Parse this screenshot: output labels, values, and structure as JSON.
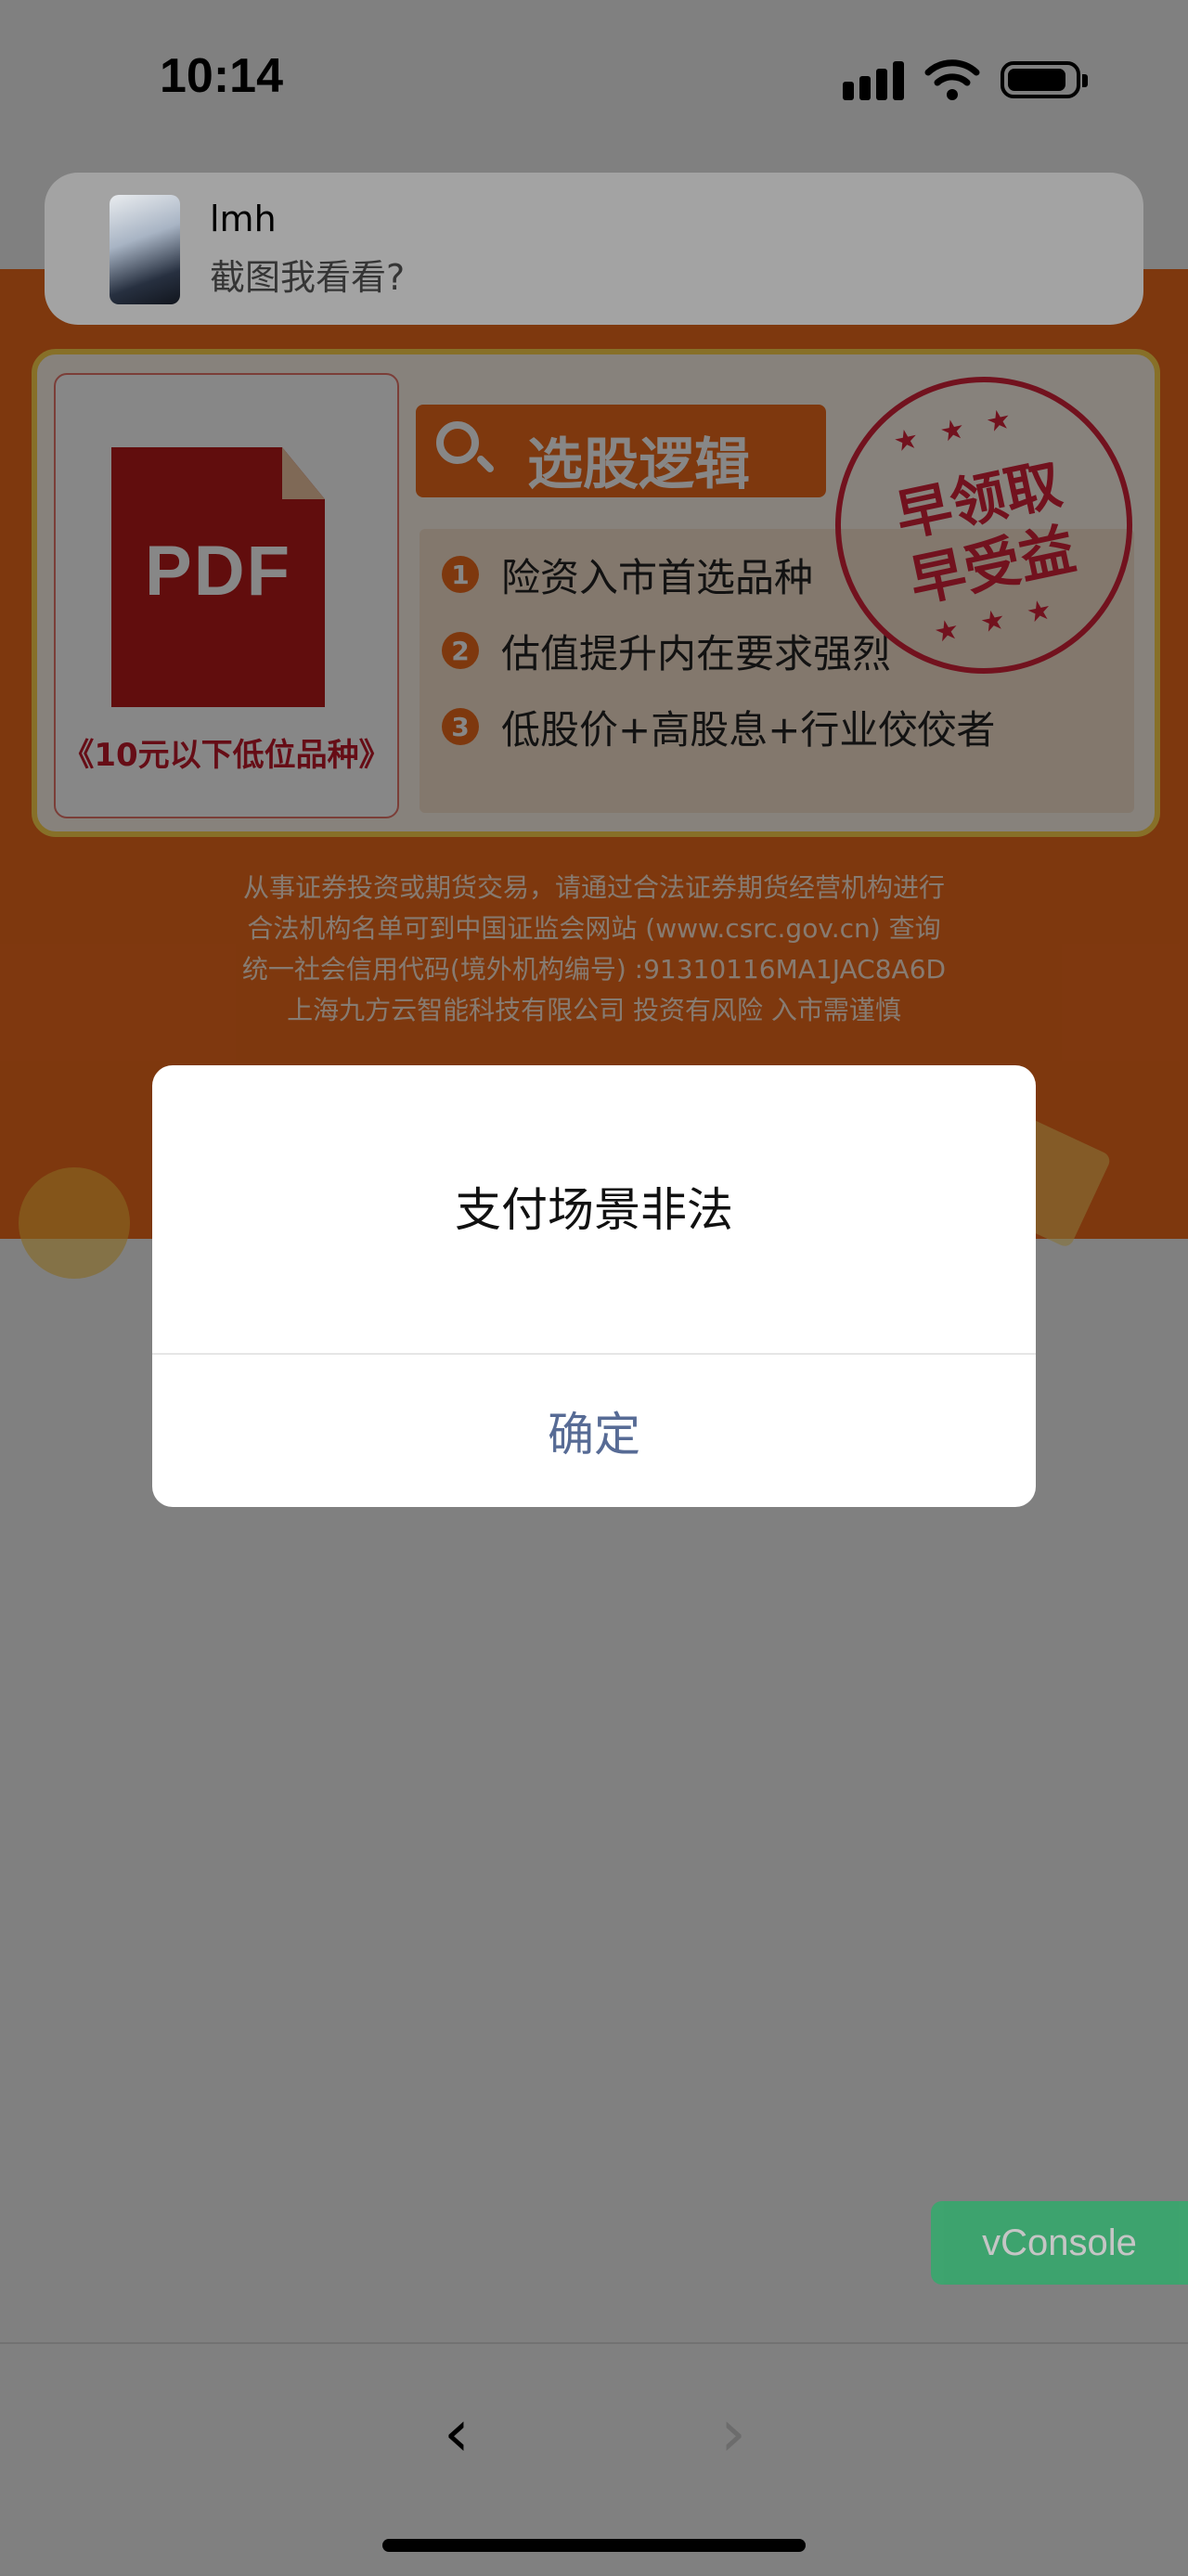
{
  "status_bar": {
    "time": "10:14"
  },
  "notification": {
    "sender": "lmh",
    "message": "截图我看看?"
  },
  "banner": {
    "pdf_label": "PDF",
    "pdf_caption": "《10元以下低位品种》",
    "logic_title": "选股逻辑",
    "stamp_line1": "早领取",
    "stamp_line2": "早受益",
    "items": [
      {
        "num": "1",
        "text": "险资入市首选品种"
      },
      {
        "num": "2",
        "text": "估值提升内在要求强烈"
      },
      {
        "num": "3",
        "text": "低股价+高股息+行业佼佼者"
      }
    ],
    "disclaimer": [
      "从事证券投资或期货交易，请通过合法证券期货经营机构进行",
      "合法机构名单可到中国证监会网站 (www.csrc.gov.cn) 查询",
      "统一社会信用代码(境外机构编号) :91310116MA1JAC8A6D",
      "上海九方云智能科技有限公司 投资有风险 入市需谨慎"
    ]
  },
  "dialog": {
    "message": "支付场景非法",
    "confirm_label": "确定"
  },
  "vconsole": {
    "label": "vConsole"
  },
  "nav": {
    "back_icon": "‹",
    "forward_icon": "›"
  },
  "colors": {
    "accent": "#ef6a1c",
    "dialog_button": "#576b95",
    "vconsole": "#07c160"
  }
}
